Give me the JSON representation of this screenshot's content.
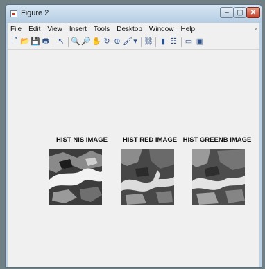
{
  "window": {
    "title": "Figure 2"
  },
  "controls": {
    "minimize": "–",
    "maximize": "▢",
    "close": "✕"
  },
  "menu": [
    "File",
    "Edit",
    "View",
    "Insert",
    "Tools",
    "Desktop",
    "Window",
    "Help"
  ],
  "menu_overflow": "›",
  "toolbar": {
    "new": "🗋",
    "open": "📂",
    "save": "💾",
    "print": "🖶",
    "arrow": "↖",
    "zoom_in": "🔍",
    "zoom_out": "🔎",
    "pan": "✋",
    "rotate": "↻",
    "datacursor": "⊕",
    "brush": "🖌",
    "brush_menu": "▾",
    "link": "⛓",
    "colorbar": "▮",
    "legend": "☷",
    "hide": "▭",
    "show": "▣"
  },
  "panels": [
    {
      "title": "HIST NIS IMAGE"
    },
    {
      "title": "HIST RED IMAGE"
    },
    {
      "title": "HIST GREENB IMAGE"
    }
  ],
  "colors": {
    "titlebar": "#bcd2e6",
    "client": "#f0f0f0",
    "close": "#c4422b"
  }
}
